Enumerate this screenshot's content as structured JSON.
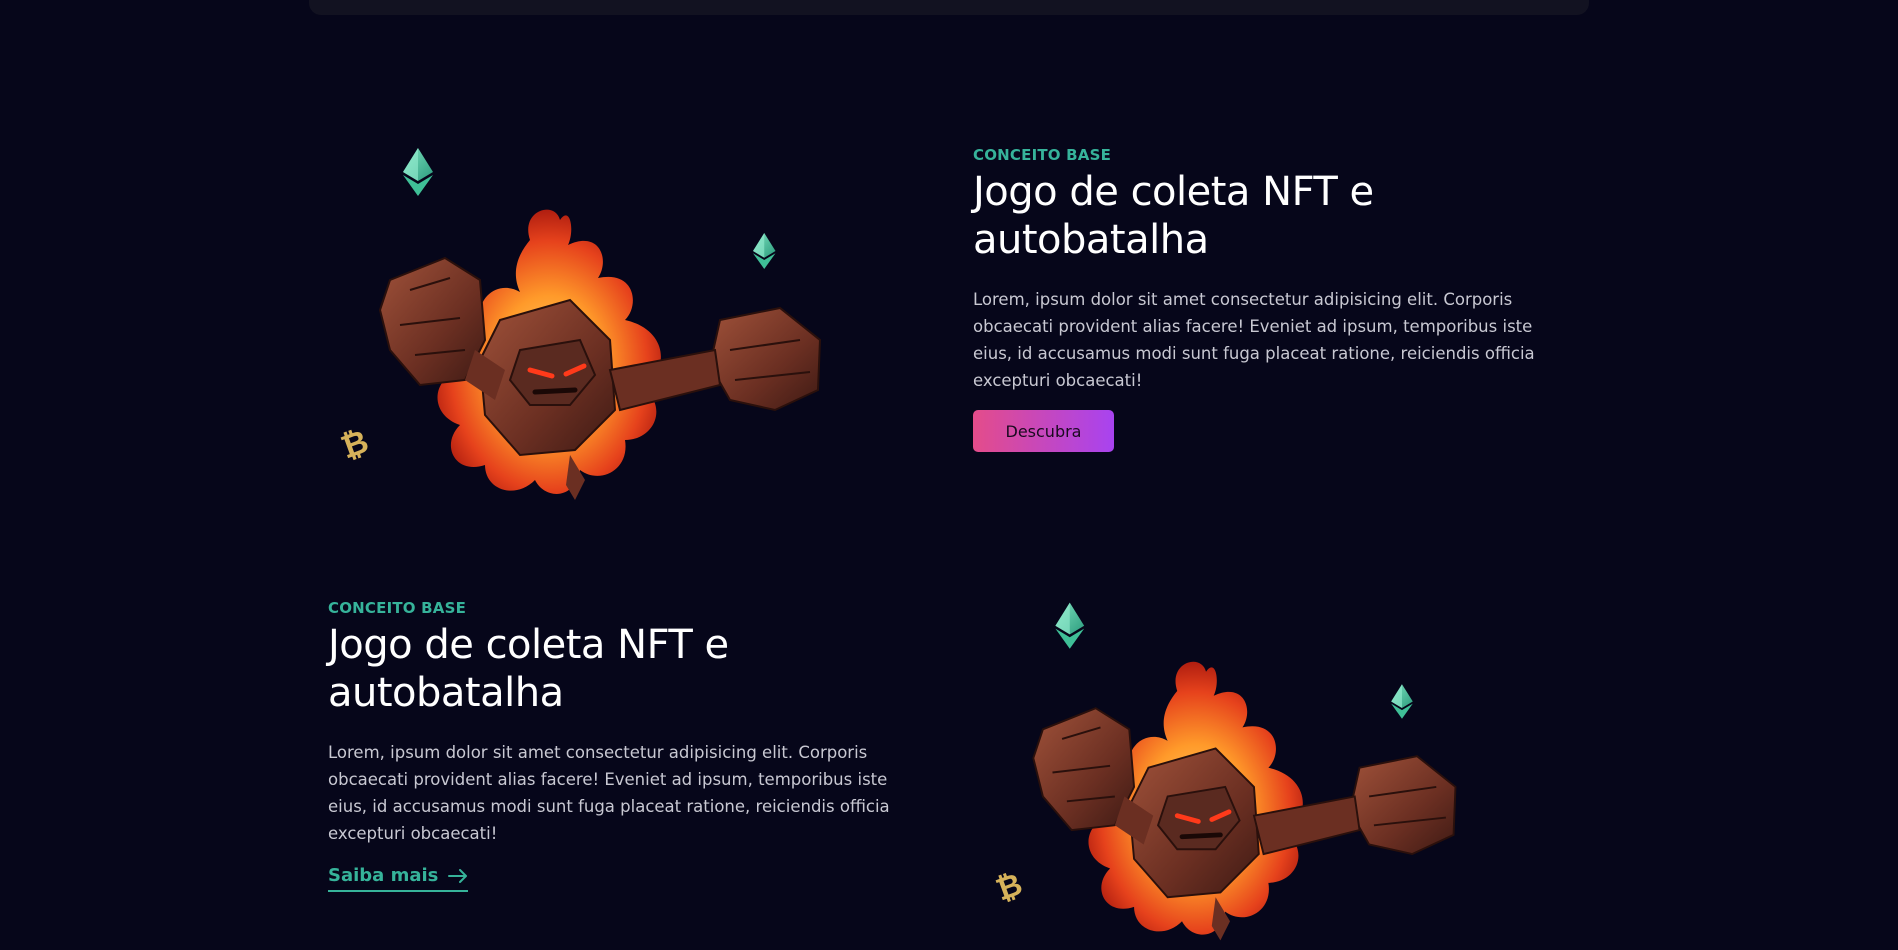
{
  "sections": [
    {
      "kicker": "CONCEITO BASE",
      "title": "Jogo de coleta NFT e autobatalha",
      "body": "Lorem, ipsum dolor sit amet consectetur adipisicing elit. Corporis obcaecati provident alias facere! Eveniet ad ipsum, temporibus iste eius, id accusamus modi sunt fuga placeat ratione, reiciendis officia excepturi obcaecati!",
      "cta_label": "Descubra"
    },
    {
      "kicker": "CONCEITO BASE",
      "title": "Jogo de coleta NFT e autobatalha",
      "body": "Lorem, ipsum dolor sit amet consectetur adipisicing elit. Corporis obcaecati provident alias facere! Eveniet ad ipsum, temporibus iste eius, id accusamus modi sunt fuga placeat ratione, reiciendis officia excepturi obcaecati!",
      "link_label": "Saiba mais"
    }
  ],
  "icons": {
    "ethereum": "ethereum-icon",
    "bitcoin": "bitcoin-icon",
    "arrow": "arrow-right-icon",
    "creature": "fire-golem-illustration"
  },
  "colors": {
    "background": "#06061a",
    "accent": "#36b39a",
    "button_gradient_start": "#e44c8a",
    "button_gradient_end": "#a843f0"
  }
}
